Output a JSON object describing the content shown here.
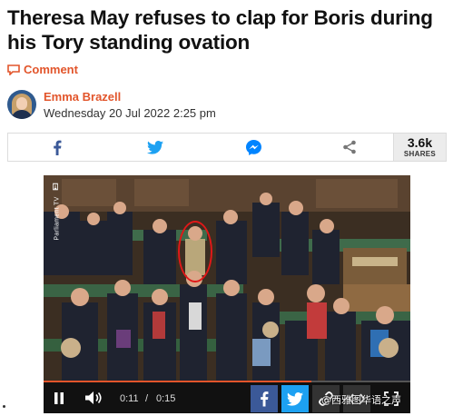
{
  "article": {
    "headline": "Theresa May refuses to clap for Boris during his Tory standing ovation",
    "comment_label": "Comment",
    "author": "Emma Brazell",
    "date": "Wednesday 20 Jul 2022 2:25 pm"
  },
  "share_bar": {
    "buttons": [
      {
        "name": "facebook",
        "icon": "facebook-icon",
        "color": "#3b5998"
      },
      {
        "name": "twitter",
        "icon": "twitter-icon",
        "color": "#1da1f2"
      },
      {
        "name": "messenger",
        "icon": "messenger-icon",
        "color": "#0084ff"
      },
      {
        "name": "share",
        "icon": "share-icon",
        "color": "#777777"
      }
    ],
    "count": "3.6k",
    "count_label": "SHARES"
  },
  "video": {
    "channel": "Parliament TV",
    "current_time": "0:11",
    "separator": "/",
    "duration": "0:15",
    "progress": 0.73,
    "highlight_color": "#e01818"
  },
  "watermark": "@西雅图华语之声",
  "colors": {
    "accent": "#e2552b",
    "facebook": "#3b5998",
    "twitter": "#1da1f2"
  }
}
